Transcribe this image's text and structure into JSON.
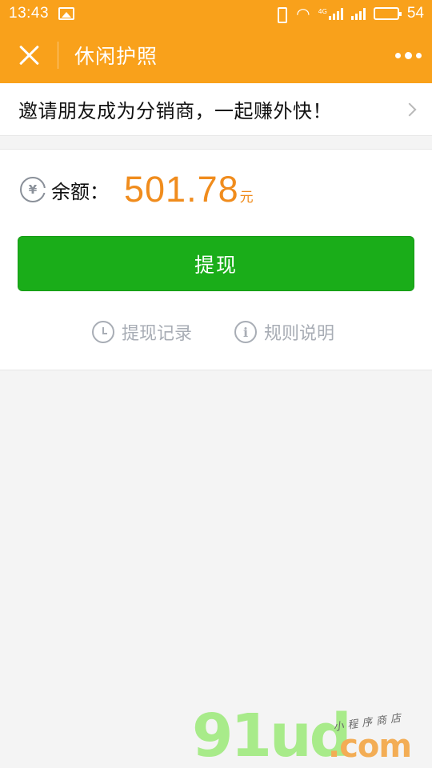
{
  "status_bar": {
    "time": "13:43",
    "network_label": "4G",
    "battery_text": "54",
    "battery_level": 0.54
  },
  "nav": {
    "title": "休闲护照"
  },
  "invite": {
    "text": "邀请朋友成为分销商，一起赚外快！"
  },
  "balance": {
    "icon_glyph": "¥",
    "label": "余额：",
    "amount": "501.78",
    "unit": "元"
  },
  "withdraw_button": {
    "label": "提现"
  },
  "links": {
    "records": "提现记录",
    "rules": "规则说明",
    "info_glyph": "i"
  },
  "watermark": {
    "brand": "91ud",
    "domain": ".com",
    "tagline": "小程序商店"
  },
  "colors": {
    "header": "#f9a11b",
    "amount": "#f08c1d",
    "button": "#1aad19"
  }
}
